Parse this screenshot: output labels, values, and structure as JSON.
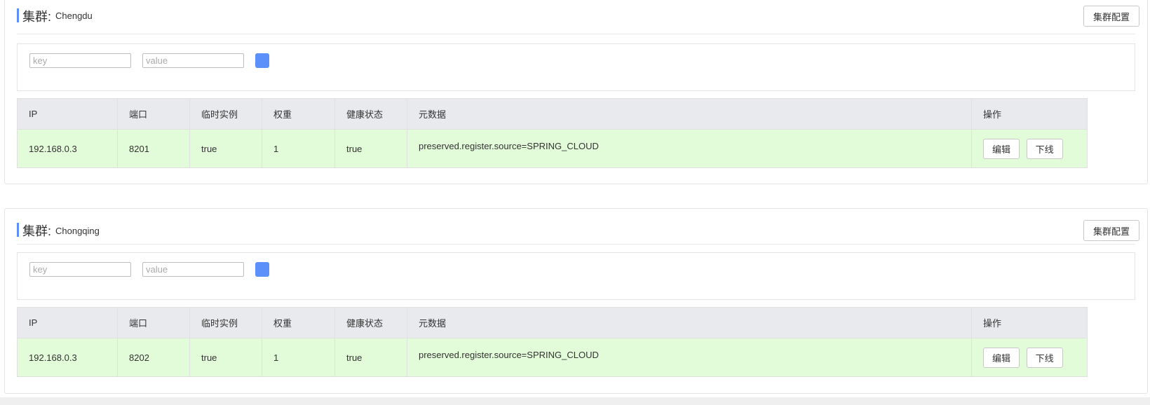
{
  "clusters": [
    {
      "label": "集群:",
      "name": "Chengdu",
      "config_button": "集群配置",
      "filter": {
        "key_placeholder": "key",
        "value_placeholder": "value"
      },
      "columns": [
        "IP",
        "端口",
        "临时实例",
        "权重",
        "健康状态",
        "元数据",
        "操作"
      ],
      "rows": [
        {
          "ip": "192.168.0.3",
          "port": "8201",
          "ephemeral": "true",
          "weight": "1",
          "healthy": "true",
          "metadata": "preserved.register.source=SPRING_CLOUD",
          "edit_label": "编辑",
          "offline_label": "下线"
        }
      ]
    },
    {
      "label": "集群:",
      "name": "Chongqing",
      "config_button": "集群配置",
      "filter": {
        "key_placeholder": "key",
        "value_placeholder": "value"
      },
      "columns": [
        "IP",
        "端口",
        "临时实例",
        "权重",
        "健康状态",
        "元数据",
        "操作"
      ],
      "rows": [
        {
          "ip": "192.168.0.3",
          "port": "8202",
          "ephemeral": "true",
          "weight": "1",
          "healthy": "true",
          "metadata": "preserved.register.source=SPRING_CLOUD",
          "edit_label": "编辑",
          "offline_label": "下线"
        }
      ]
    }
  ],
  "colors": {
    "accent": "#5b8ff9",
    "header_row_bg": "#e9eaee",
    "data_row_bg": "#e2fbd8"
  }
}
